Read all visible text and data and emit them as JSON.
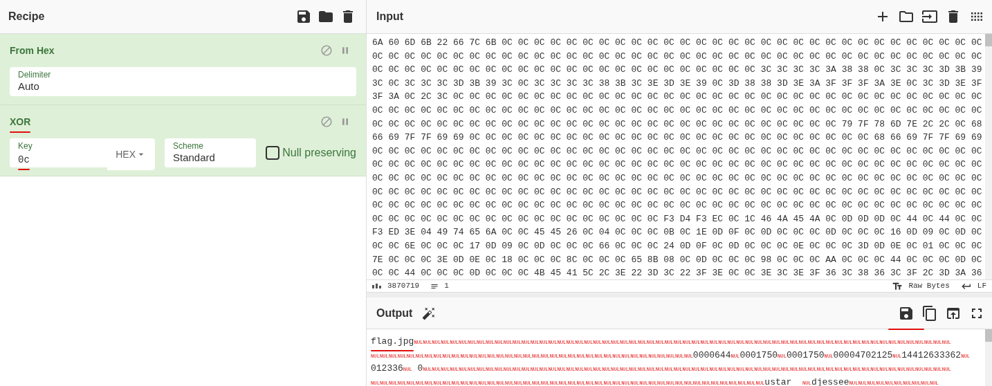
{
  "recipe": {
    "title": "Recipe",
    "operations": [
      {
        "name": "From Hex",
        "underlined": false,
        "args": [
          {
            "kind": "text",
            "label": "Delimiter",
            "value": "Auto"
          }
        ]
      },
      {
        "name": "XOR",
        "underlined": true,
        "args": [
          {
            "kind": "key",
            "label": "Key",
            "value": "0c",
            "format": "HEX",
            "underlined": true
          },
          {
            "kind": "text",
            "label": "Scheme",
            "value": "Standard"
          },
          {
            "kind": "checkbox",
            "label": "Null preserving",
            "checked": false
          }
        ]
      }
    ]
  },
  "input": {
    "title": "Input",
    "lines": [
      "6A 60 6D 6B 22 66 7C 6B 0C 0C 0C 0C 0C 0C 0C 0C 0C 0C 0C 0C 0C 0C 0C 0C 0C 0C 0C 0C 0C 0C 0C 0C 0C 0C 0C 0C 0C 0C",
      "0C 0C 0C 0C 0C 0C 0C 0C 0C 0C 0C 0C 0C 0C 0C 0C 0C 0C 0C 0C 0C 0C 0C 0C 0C 0C 0C 0C 0C 0C 0C 0C 0C 0C 0C 0C 0C 0C",
      "0C 0C 0C 0C 0C 0C 0C 0C 0C 0C 0C 0C 0C 0C 0C 0C 0C 0C 0C 0C 0C 0C 0C 0C 3C 3C 3C 3C 3A 38 38 0C 3C 3C 3C 3D 3B 39",
      "3C 0C 3C 3C 3C 3D 3B 39 3C 0C 3C 3C 3C 3C 38 3B 3C 3E 3D 3E 39 0C 3D 38 38 3D 3E 3A 3F 3F 3F 3A 3E 0C 3C 3D 3E 3F",
      "3F 3A 0C 2C 3C 0C 0C 0C 0C 0C 0C 0C 0C 0C 0C 0C 0C 0C 0C 0C 0C 0C 0C 0C 0C 0C 0C 0C 0C 0C 0C 0C 0C 0C 0C 0C 0C 0C",
      "0C 0C 0C 0C 0C 0C 0C 0C 0C 0C 0C 0C 0C 0C 0C 0C 0C 0C 0C 0C 0C 0C 0C 0C 0C 0C 0C 0C 0C 0C 0C 0C 0C 0C 0C 0C 0C 0C",
      "0C 0C 0C 0C 0C 0C 0C 0C 0C 0C 0C 0C 0C 0C 0C 0C 0C 0C 0C 0C 0C 0C 0C 0C 0C 0C 0C 0C 0C 79 7F 78 6D 7E 2C 2C 0C 68",
      "66 69 7F 7F 69 69 0C 0C 0C 0C 0C 0C 0C 0C 0C 0C 0C 0C 0C 0C 0C 0C 0C 0C 0C 0C 0C 0C 0C 0C 0C 68 66 69 7F 7F 69 69",
      "0C 0C 0C 0C 0C 0C 0C 0C 0C 0C 0C 0C 0C 0C 0C 0C 0C 0C 0C 0C 0C 0C 0C 0C 0C 0C 0C 0C 0C 0C 0C 0C 0C 0C 0C 0C 0C 0C",
      "0C 0C 0C 0C 0C 0C 0C 0C 0C 0C 0C 0C 0C 0C 0C 0C 0C 0C 0C 0C 0C 0C 0C 0C 0C 0C 0C 0C 0C 0C 0C 0C 0C 0C 0C 0C 0C 0C",
      "0C 0C 0C 0C 0C 0C 0C 0C 0C 0C 0C 0C 0C 0C 0C 0C 0C 0C 0C 0C 0C 0C 0C 0C 0C 0C 0C 0C 0C 0C 0C 0C 0C 0C 0C 0C 0C 0C",
      "0C 0C 0C 0C 0C 0C 0C 0C 0C 0C 0C 0C 0C 0C 0C 0C 0C 0C 0C 0C 0C 0C 0C 0C 0C 0C 0C 0C 0C 0C 0C 0C 0C 0C 0C 0C 0C 0C",
      "0C 0C 0C 0C 0C 0C 0C 0C 0C 0C 0C 0C 0C 0C 0C 0C 0C 0C 0C 0C 0C 0C 0C 0C 0C 0C 0C 0C 0C 0C 0C 0C 0C 0C 0C 0C 0C 0C",
      "0C 0C 0C 0C 0C 0C 0C 0C 0C 0C 0C 0C 0C 0C 0C 0C 0C 0C F3 D4 F3 EC 0C 1C 46 4A 45 4A 0C 0D 0D 0D 0C 44 0C 44 0C 0C",
      "F3 ED 3E 04 49 74 65 6A 0C 0C 45 45 26 0C 04 0C 0C 0C 0B 0C 1E 0D 0F 0C 0D 0C 0C 0C 0D 0C 0C 0C 16 0D 09 0C 0D 0C",
      "0C 0C 6E 0C 0C 0C 17 0D 09 0C 0D 0C 0C 0C 66 0C 0C 0C 24 0D 0F 0C 0D 0C 0C 0C 0E 0C 0C 0C 3D 0D 0E 0C 01 0C 0C 0C",
      "7E 0C 0C 0C 3E 0D 0E 0C 18 0C 0C 0C 8C 0C 0C 0C 65 8B 08 0C 0D 0C 0C 0C 98 0C 0C 0C AA 0C 0C 0C 44 0C 0C 0C 0D 0C",
      "0C 0C 44 0C 0C 0C 0D 0C 0C 0C 4B 45 41 5C 2C 3E 22 3D 3C 22 3F 3E 0C 0C 3E 3C 3E 3F 36 3C 38 36 3C 3F 2C 3D 3A 36"
    ],
    "status": {
      "length": "3870719",
      "lines": "1",
      "encoding": "Raw Bytes",
      "eol": "LF"
    }
  },
  "output": {
    "title": "Output",
    "save_underlined": true,
    "lines": [
      [
        {
          "kind": "text",
          "text": "flag.jpg",
          "underlined": true
        },
        {
          "kind": "control",
          "text": "NULNULNULNULNULNULNULNULNULNULNULNULNULNULNULNULNULNULNULNULNULNULNULNULNULNULNULNULNULNULNULNULNULNULNULNULNULNULNULNULNULNULNULNULNULNULNULNULNULNULNULNULNULNULNULNULNULNULNULNUL"
        }
      ],
      [
        {
          "kind": "control",
          "text": "NULNULNULNULNULNULNULNULNULNULNULNULNULNULNULNULNULNULNULNULNULNULNULNULNULNULNULNULNULNULNULNULNULNULNULNUL"
        },
        {
          "kind": "text",
          "text": "0000644"
        },
        {
          "kind": "control",
          "text": "NUL"
        },
        {
          "kind": "text",
          "text": "0001750"
        },
        {
          "kind": "control",
          "text": "NUL"
        },
        {
          "kind": "text",
          "text": "0001750"
        },
        {
          "kind": "control",
          "text": "NUL"
        },
        {
          "kind": "text",
          "text": "00004702125"
        },
        {
          "kind": "control",
          "text": "NUL"
        },
        {
          "kind": "text",
          "text": "14412633362"
        },
        {
          "kind": "control",
          "text": "NUL"
        }
      ],
      [
        {
          "kind": "text",
          "text": "012336"
        },
        {
          "kind": "control",
          "text": "NUL"
        },
        {
          "kind": "text",
          "text": " 0"
        },
        {
          "kind": "control",
          "text": "NULNULNULNULNULNULNULNULNULNULNULNULNULNULNULNULNULNULNULNULNULNULNULNULNULNULNULNULNULNULNULNULNULNULNULNULNULNULNULNULNULNULNULNULNULNULNULNULNULNULNULNULNULNULNULNULNULNULNUL"
        }
      ],
      [
        {
          "kind": "control",
          "text": "NULNULNULNULNULNULNULNULNULNULNULNULNULNULNULNULNULNULNULNULNULNULNULNULNULNULNULNULNULNULNULNULNULNULNULNULNULNULNULNULNULNULNULNUL"
        },
        {
          "kind": "text",
          "text": "ustar  "
        },
        {
          "kind": "control",
          "text": "NUL"
        },
        {
          "kind": "text",
          "text": "djessee"
        },
        {
          "kind": "control",
          "text": "NULNULNULNULNULNULNULNULNULNUL"
        }
      ]
    ]
  }
}
